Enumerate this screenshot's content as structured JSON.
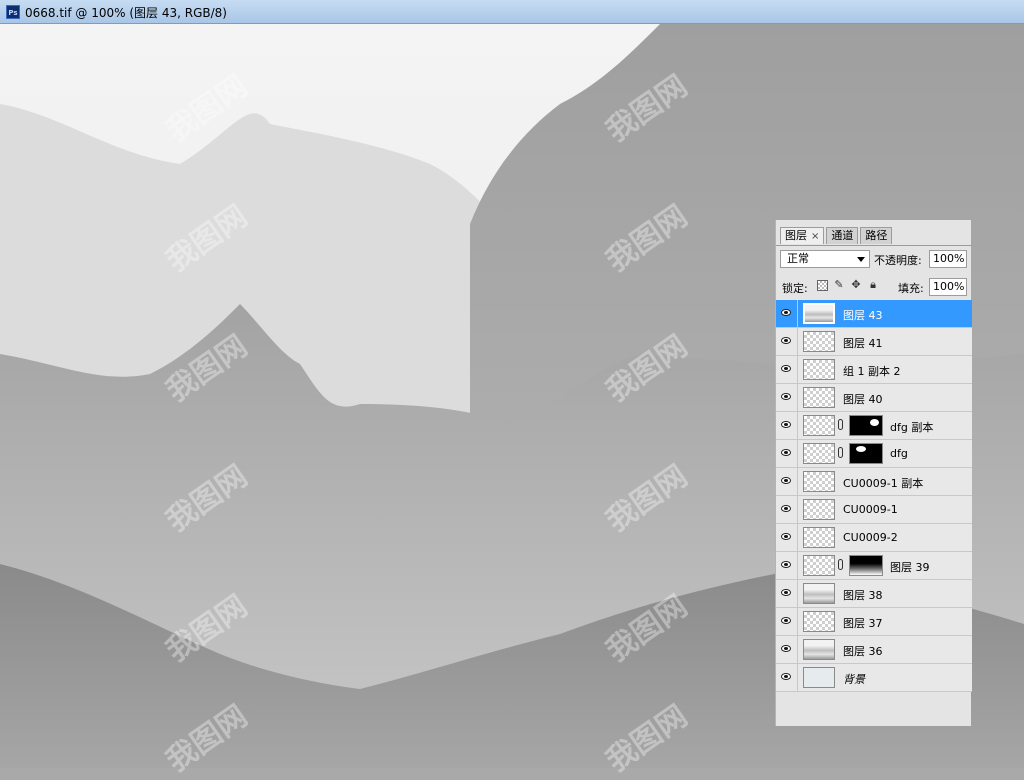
{
  "window": {
    "title": "0668.tif @ 100% (图层 43, RGB/8)",
    "app_icon": "photoshop-icon"
  },
  "canvas": {
    "watermark_text": "我图网"
  },
  "layers_panel": {
    "tabs": [
      {
        "label": "图层",
        "active": true,
        "close": "×"
      },
      {
        "label": "通道",
        "active": false
      },
      {
        "label": "路径",
        "active": false
      }
    ],
    "blend_mode": "正常",
    "opacity_label": "不透明度:",
    "opacity_value": "100%",
    "lock_label": "锁定:",
    "fill_label": "填充:",
    "fill_value": "100%",
    "layers": [
      {
        "name": "图层 43",
        "visible": true,
        "selected": true
      },
      {
        "name": "图层 41",
        "visible": true
      },
      {
        "name": "组 1 副本 2",
        "visible": true
      },
      {
        "name": "图层 40",
        "visible": true
      },
      {
        "name": "dfg 副本",
        "visible": true,
        "has_mask": true
      },
      {
        "name": "dfg",
        "visible": true,
        "has_mask": true
      },
      {
        "name": "CU0009-1 副本",
        "visible": true
      },
      {
        "name": "CU0009-1",
        "visible": true
      },
      {
        "name": "CU0009-2",
        "visible": true
      },
      {
        "name": "图层 39",
        "visible": true,
        "has_mask": true
      },
      {
        "name": "图层 38",
        "visible": true
      },
      {
        "name": "图层 37",
        "visible": true
      },
      {
        "name": "图层 36",
        "visible": true
      },
      {
        "name": "背景",
        "visible": true
      }
    ]
  },
  "colors": {
    "selection": "#3399ff",
    "titlebar": "#b8d2ee",
    "panel_bg": "#e4e4e4"
  }
}
